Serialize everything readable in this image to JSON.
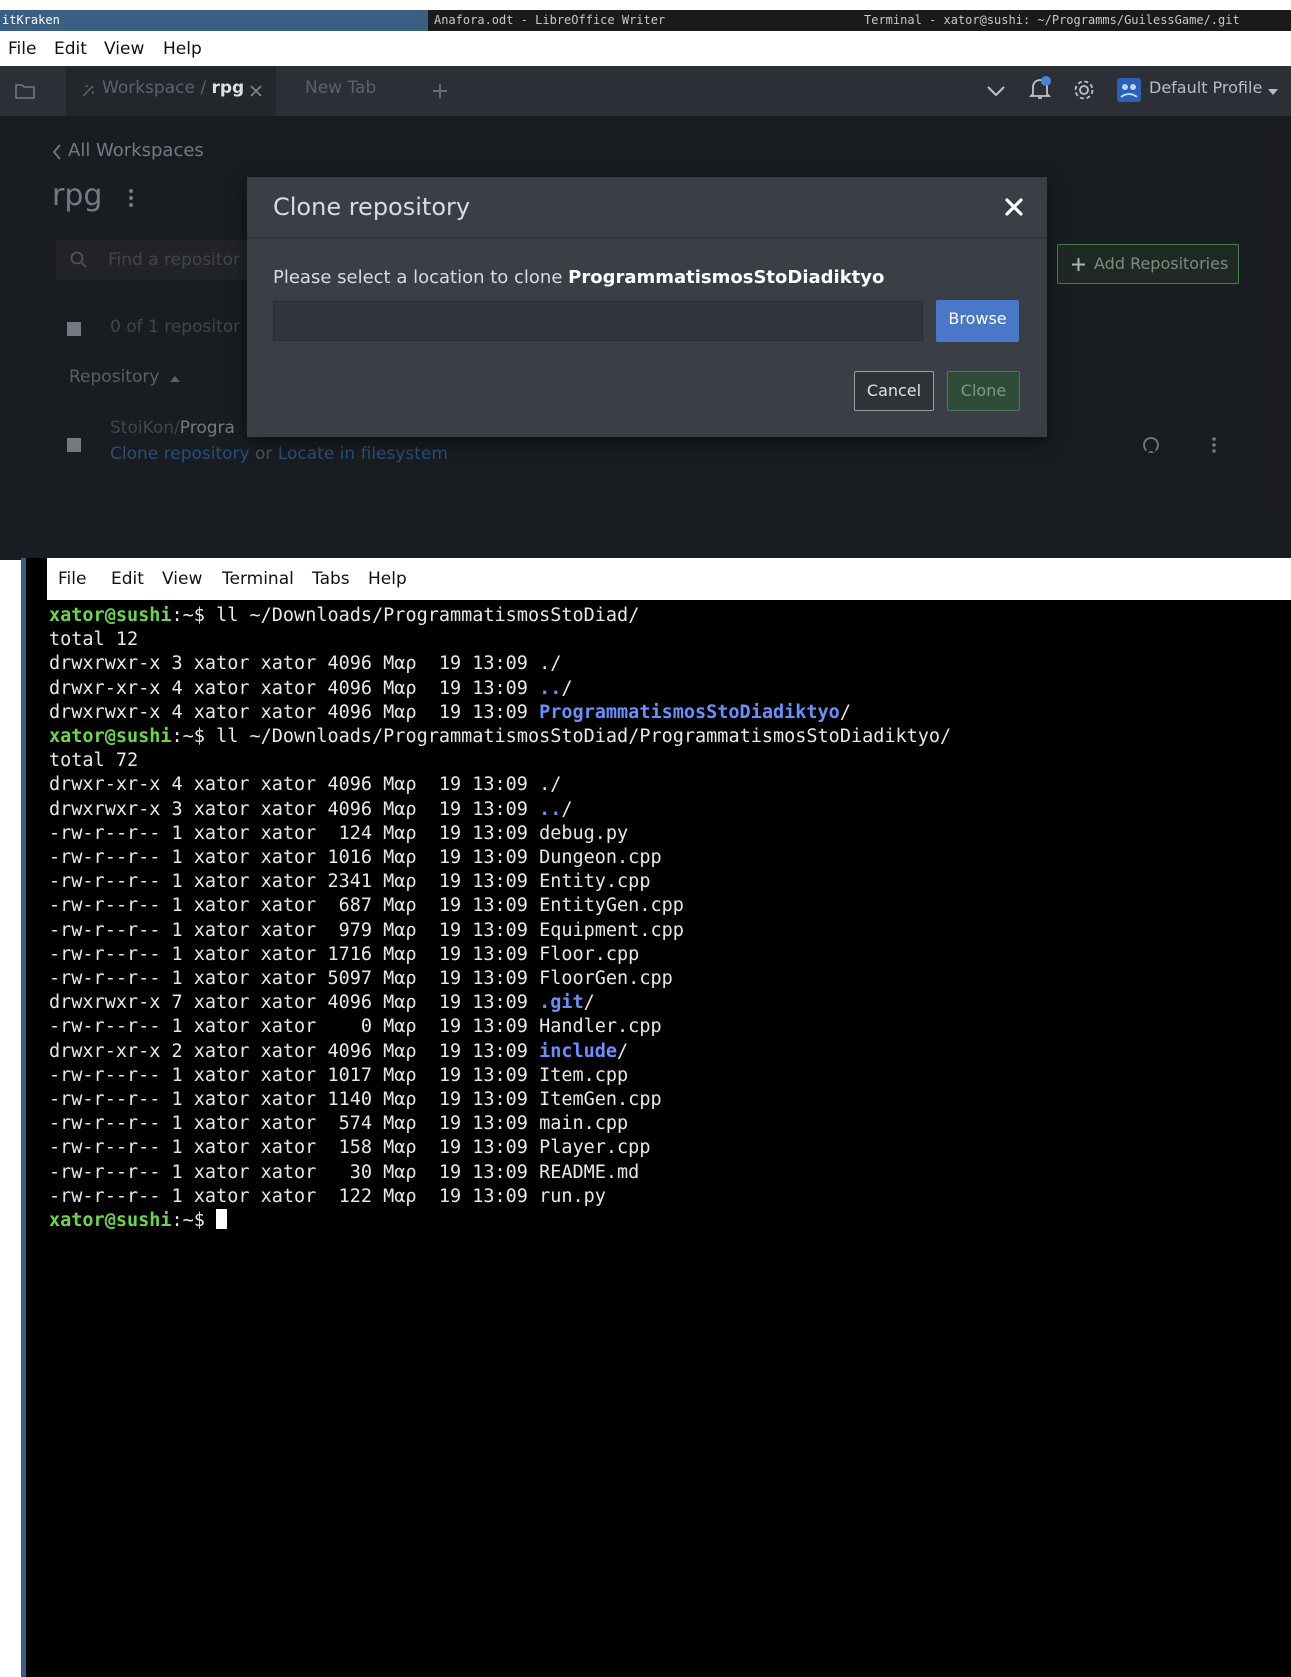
{
  "taskbar": {
    "tasks": [
      {
        "label": "itKraken"
      },
      {
        "label": "Anafora.odt - LibreOffice Writer"
      },
      {
        "label": "Terminal - xator@sushi: ~/Programms/GuilessGame/.git"
      }
    ]
  },
  "gitkraken": {
    "menubar": [
      "File",
      "Edit",
      "View",
      "Help"
    ],
    "tabs": {
      "workspace_prefix": "Workspace / ",
      "workspace_name": "rpg",
      "new_tab": "New Tab"
    },
    "profile": "Default Profile",
    "back_link": "All Workspaces",
    "workspace_title": "rpg",
    "search_placeholder": "Find a repositor",
    "repo_count": "0 of 1 repositor",
    "column_header": "Repository",
    "add_repositories": "Add Repositories",
    "repo_row": {
      "owner": "StoiKon/",
      "name": "Progra",
      "clone_link": "Clone repository",
      "or_text": " or ",
      "locate_link": "Locate in filesystem"
    }
  },
  "clone_dialog": {
    "title": "Clone repository",
    "message_prefix": "Please select a location to clone ",
    "repo_name": "ProgrammatismosStoDiadiktyo",
    "path_value": "",
    "browse_label": "Browse",
    "cancel_label": "Cancel",
    "clone_label": "Clone"
  },
  "terminal": {
    "menubar": [
      "File",
      "Edit",
      "View",
      "Terminal",
      "Tabs",
      "Help"
    ],
    "prompt": "xator@sushi",
    "prompt_suffix": ":~$ ",
    "lines": [
      {
        "type": "cmd",
        "text": "ll ~/Downloads/ProgrammatismosStoDiad/"
      },
      {
        "type": "out",
        "text": "total 12"
      },
      {
        "type": "ls",
        "prefix": "drwxrwxr-x 3 xator xator 4096 Μαρ  19 13:09 ",
        "name": "./",
        "dir": false
      },
      {
        "type": "ls",
        "prefix": "drwxr-xr-x 4 xator xator 4096 Μαρ  19 13:09 ",
        "name": "..",
        "dir": true,
        "suffix": "/"
      },
      {
        "type": "ls",
        "prefix": "drwxrwxr-x 4 xator xator 4096 Μαρ  19 13:09 ",
        "name": "ProgrammatismosStoDiadiktyo",
        "dir": true,
        "suffix": "/"
      },
      {
        "type": "cmd",
        "text": "ll ~/Downloads/ProgrammatismosStoDiad/ProgrammatismosStoDiadiktyo/"
      },
      {
        "type": "out",
        "text": "total 72"
      },
      {
        "type": "ls",
        "prefix": "drwxr-xr-x 4 xator xator 4096 Μαρ  19 13:09 ",
        "name": "./",
        "dir": false
      },
      {
        "type": "ls",
        "prefix": "drwxrwxr-x 3 xator xator 4096 Μαρ  19 13:09 ",
        "name": "..",
        "dir": true,
        "suffix": "/"
      },
      {
        "type": "ls",
        "prefix": "-rw-r--r-- 1 xator xator  124 Μαρ  19 13:09 ",
        "name": "debug.py",
        "dir": false
      },
      {
        "type": "ls",
        "prefix": "-rw-r--r-- 1 xator xator 1016 Μαρ  19 13:09 ",
        "name": "Dungeon.cpp",
        "dir": false
      },
      {
        "type": "ls",
        "prefix": "-rw-r--r-- 1 xator xator 2341 Μαρ  19 13:09 ",
        "name": "Entity.cpp",
        "dir": false
      },
      {
        "type": "ls",
        "prefix": "-rw-r--r-- 1 xator xator  687 Μαρ  19 13:09 ",
        "name": "EntityGen.cpp",
        "dir": false
      },
      {
        "type": "ls",
        "prefix": "-rw-r--r-- 1 xator xator  979 Μαρ  19 13:09 ",
        "name": "Equipment.cpp",
        "dir": false
      },
      {
        "type": "ls",
        "prefix": "-rw-r--r-- 1 xator xator 1716 Μαρ  19 13:09 ",
        "name": "Floor.cpp",
        "dir": false
      },
      {
        "type": "ls",
        "prefix": "-rw-r--r-- 1 xator xator 5097 Μαρ  19 13:09 ",
        "name": "FloorGen.cpp",
        "dir": false
      },
      {
        "type": "ls",
        "prefix": "drwxrwxr-x 7 xator xator 4096 Μαρ  19 13:09 ",
        "name": ".git",
        "dir": true,
        "suffix": "/"
      },
      {
        "type": "ls",
        "prefix": "-rw-r--r-- 1 xator xator    0 Μαρ  19 13:09 ",
        "name": "Handler.cpp",
        "dir": false
      },
      {
        "type": "ls",
        "prefix": "drwxr-xr-x 2 xator xator 4096 Μαρ  19 13:09 ",
        "name": "include",
        "dir": true,
        "suffix": "/"
      },
      {
        "type": "ls",
        "prefix": "-rw-r--r-- 1 xator xator 1017 Μαρ  19 13:09 ",
        "name": "Item.cpp",
        "dir": false
      },
      {
        "type": "ls",
        "prefix": "-rw-r--r-- 1 xator xator 1140 Μαρ  19 13:09 ",
        "name": "ItemGen.cpp",
        "dir": false
      },
      {
        "type": "ls",
        "prefix": "-rw-r--r-- 1 xator xator  574 Μαρ  19 13:09 ",
        "name": "main.cpp",
        "dir": false
      },
      {
        "type": "ls",
        "prefix": "-rw-r--r-- 1 xator xator  158 Μαρ  19 13:09 ",
        "name": "Player.cpp",
        "dir": false
      },
      {
        "type": "ls",
        "prefix": "-rw-r--r-- 1 xator xator   30 Μαρ  19 13:09 ",
        "name": "README.md",
        "dir": false
      },
      {
        "type": "ls",
        "prefix": "-rw-r--r-- 1 xator xator  122 Μαρ  19 13:09 ",
        "name": "run.py",
        "dir": false
      },
      {
        "type": "cursor",
        "text": ""
      }
    ]
  },
  "colors": {
    "taskbar_active": "#3b5f82",
    "gk_background": "#1e2126",
    "dialog_background": "#3a3f46",
    "browse_button": "#4a77c8",
    "clone_button": "#2f4a37",
    "add_repos_accent": "#4c9a5b",
    "link": "#3b80c6",
    "terminal_prompt": "#6bd64b",
    "terminal_directory": "#6a8fff"
  },
  "icons": [
    "folder-icon",
    "workspace-icon",
    "close-icon",
    "plus-icon",
    "chevron-down-icon",
    "bell-icon",
    "gear-icon",
    "profile-avatar-icon",
    "caret-down-icon",
    "chevron-left-icon",
    "kebab-icon",
    "search-icon",
    "checkbox-icon",
    "sort-up-icon",
    "github-icon"
  ]
}
